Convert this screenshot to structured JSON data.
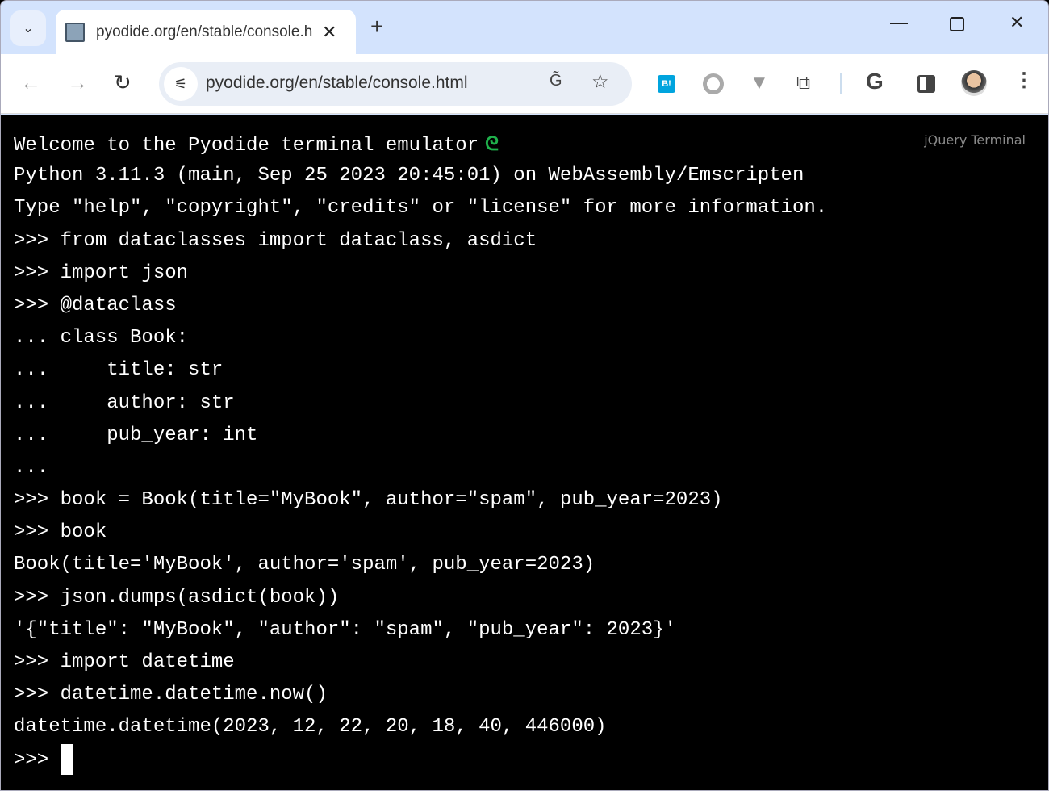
{
  "browser": {
    "tab_title": "pyodide.org/en/stable/console.html",
    "url": "pyodide.org/en/stable/console.html",
    "icons": [
      "tab-search-icon",
      "tab-favicon",
      "close-icon",
      "new-tab-icon",
      "minimize-icon",
      "maximize-icon",
      "window-close-icon",
      "back-icon",
      "forward-icon",
      "reload-icon",
      "site-settings-icon",
      "translate-icon",
      "bookmark-star-icon",
      "hatena-bookmark-icon",
      "circle-extension-icon",
      "vivaldi-extension-icon",
      "extensions-puzzle-icon",
      "google-icon",
      "side-panel-icon",
      "profile-avatar",
      "menu-icon"
    ]
  },
  "terminal": {
    "badge": "jQuery Terminal",
    "welcome": "Welcome to the Pyodide terminal emulator",
    "lines": [
      "Python 3.11.3 (main, Sep 25 2023 20:45:01) on WebAssembly/Emscripten",
      "Type \"help\", \"copyright\", \"credits\" or \"license\" for more information.",
      ">>> from dataclasses import dataclass, asdict",
      ">>> import json",
      ">>> @dataclass",
      "... class Book:",
      "...     title: str",
      "...     author: str",
      "...     pub_year: int",
      "...",
      ">>> book = Book(title=\"MyBook\", author=\"spam\", pub_year=2023)",
      ">>> book",
      "Book(title='MyBook', author='spam', pub_year=2023)",
      ">>> json.dumps(asdict(book))",
      "'{\"title\": \"MyBook\", \"author\": \"spam\", \"pub_year\": 2023}'",
      ">>> import datetime",
      ">>> datetime.datetime.now()",
      "datetime.datetime(2023, 12, 22, 20, 18, 40, 446000)"
    ],
    "prompt": ">>> "
  }
}
